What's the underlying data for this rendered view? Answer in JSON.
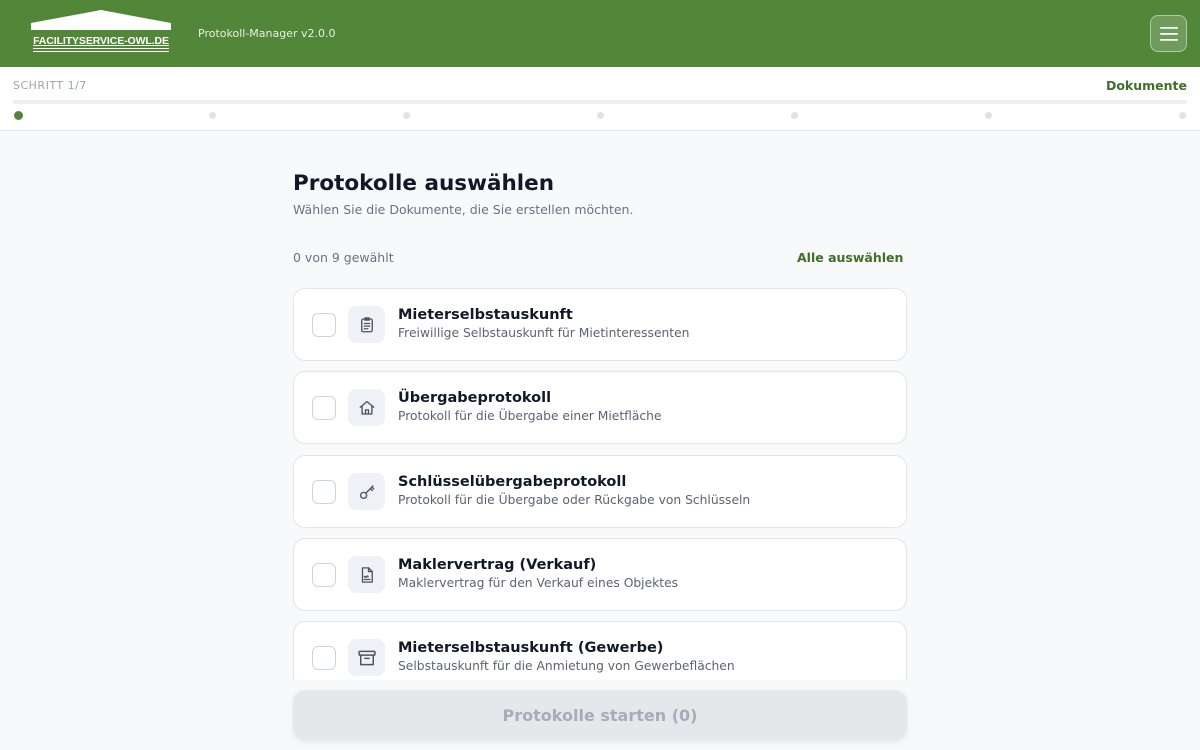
{
  "header": {
    "logo_text": "FACILITYSERVICE-OWL.DE",
    "version": "Protokoll-Manager v2.0.0",
    "menu_icon": "hamburger-menu-icon"
  },
  "steps": {
    "label": "SCHRITT 1/7",
    "current_title": "Dokumente",
    "total": 7,
    "current": 1
  },
  "main": {
    "title": "Protokolle auswählen",
    "subtitle": "Wählen Sie die Dokumente, die Sie erstellen möchten.",
    "count": "0 von 9 gewählt",
    "select_all": "Alle auswählen"
  },
  "documents": [
    {
      "title": "Mieterselbstauskunft",
      "description": "Freiwillige Selbstauskunft für Mietinteressenten",
      "icon": "clipboard-icon",
      "checked": false
    },
    {
      "title": "Übergabeprotokoll",
      "description": "Protokoll für die Übergabe einer Mietfläche",
      "icon": "house-icon",
      "checked": false
    },
    {
      "title": "Schlüsselübergabeprotokoll",
      "description": "Protokoll für die Übergabe oder Rückgabe von Schlüsseln",
      "icon": "key-icon",
      "checked": false
    },
    {
      "title": "Maklervertrag (Verkauf)",
      "description": "Maklervertrag für den Verkauf eines Objektes",
      "icon": "document-icon",
      "checked": false
    },
    {
      "title": "Mieterselbstauskunft (Gewerbe)",
      "description": "Selbstauskunft für die Anmietung von Gewerbeflächen",
      "icon": "archive-box-icon",
      "checked": false
    }
  ],
  "footer": {
    "start_button": "Protokolle starten (0)"
  },
  "colors": {
    "brand_green": "#528639",
    "accent_text": "#3f6f28",
    "background": "#f8f9fb"
  }
}
